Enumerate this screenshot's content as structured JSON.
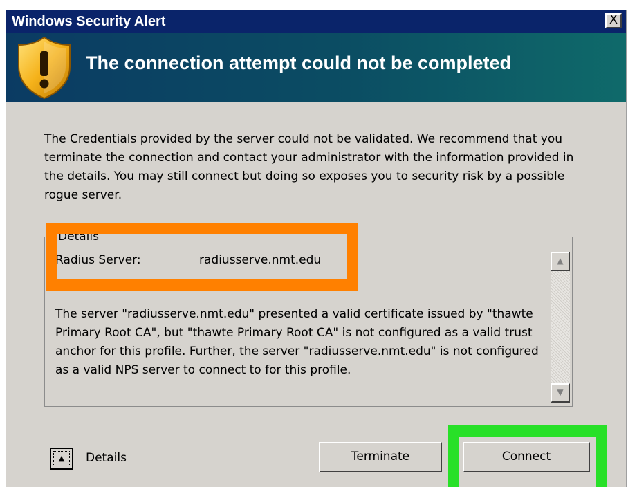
{
  "window": {
    "title": "Windows Security Alert",
    "close_symbol": "X"
  },
  "banner": {
    "icon": "warning-shield-icon",
    "heading": "The connection attempt could not be completed"
  },
  "message": "The Credentials provided by the server could not be validated. We recommend that you terminate the connection and contact your administrator with the information provided in the details. You may still connect but doing so exposes you to security risk by a possible rogue server.",
  "details": {
    "legend": "Details",
    "radius_label": "Radius Server:",
    "radius_value": "radiusserve.nmt.edu",
    "body": "The server \"radiusserve.nmt.edu\" presented a valid certificate issued by \"thawte Primary Root CA\", but \"thawte Primary Root CA\" is not configured as a valid trust anchor for this profile. Further, the server \"radiusserve.nmt.edu\" is not configured as a valid NPS server to connect to for this profile."
  },
  "footer": {
    "toggle_label": "Details",
    "terminate_first": "T",
    "terminate_rest": "erminate",
    "connect_first": "C",
    "connect_rest": "onnect"
  },
  "colors": {
    "titlebar": "#0a246a",
    "dialog_bg": "#d6d3ce",
    "highlight_orange": "#ff8000",
    "highlight_green": "#28e028"
  }
}
